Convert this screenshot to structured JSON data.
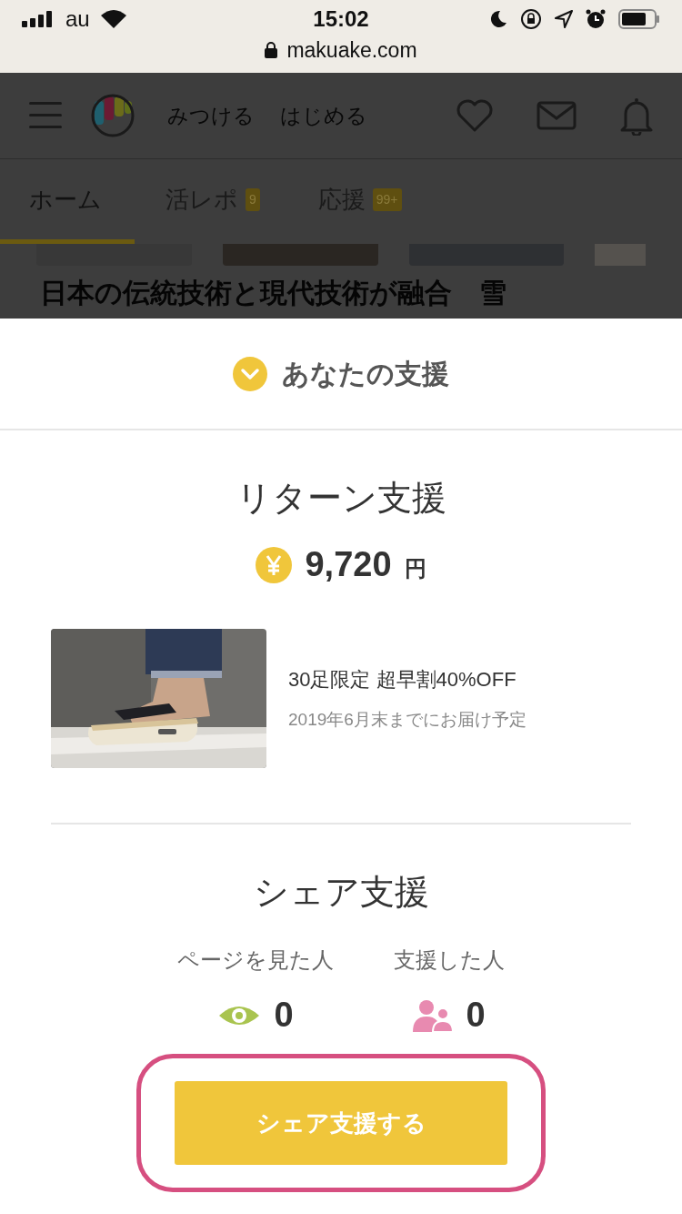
{
  "status_bar": {
    "carrier": "au",
    "time": "15:02"
  },
  "browser": {
    "url": "makuake.com"
  },
  "header": {
    "nav_links": [
      "みつける",
      "はじめる"
    ]
  },
  "tabs": [
    {
      "label": "ホーム",
      "selected": true
    },
    {
      "label": "活レポ",
      "badge": "9",
      "selected": false
    },
    {
      "label": "応援",
      "badge": "99+",
      "selected": false
    }
  ],
  "project_title": "日本の伝統技術と現代技術が融合　雪",
  "sheet": {
    "title": "あなたの支援",
    "return_support": {
      "heading": "リターン支援",
      "amount": "9,720",
      "currency": "円",
      "reward": {
        "title": "30足限定 超早割40%OFF",
        "delivery": "2019年6月末までにお届け予定"
      }
    },
    "share_support": {
      "heading": "シェア支援",
      "stats": [
        {
          "kind": "views",
          "label": "ページを見た人",
          "value": "0"
        },
        {
          "kind": "supporters",
          "label": "支援した人",
          "value": "0"
        }
      ],
      "button": "シェア支援する"
    }
  }
}
